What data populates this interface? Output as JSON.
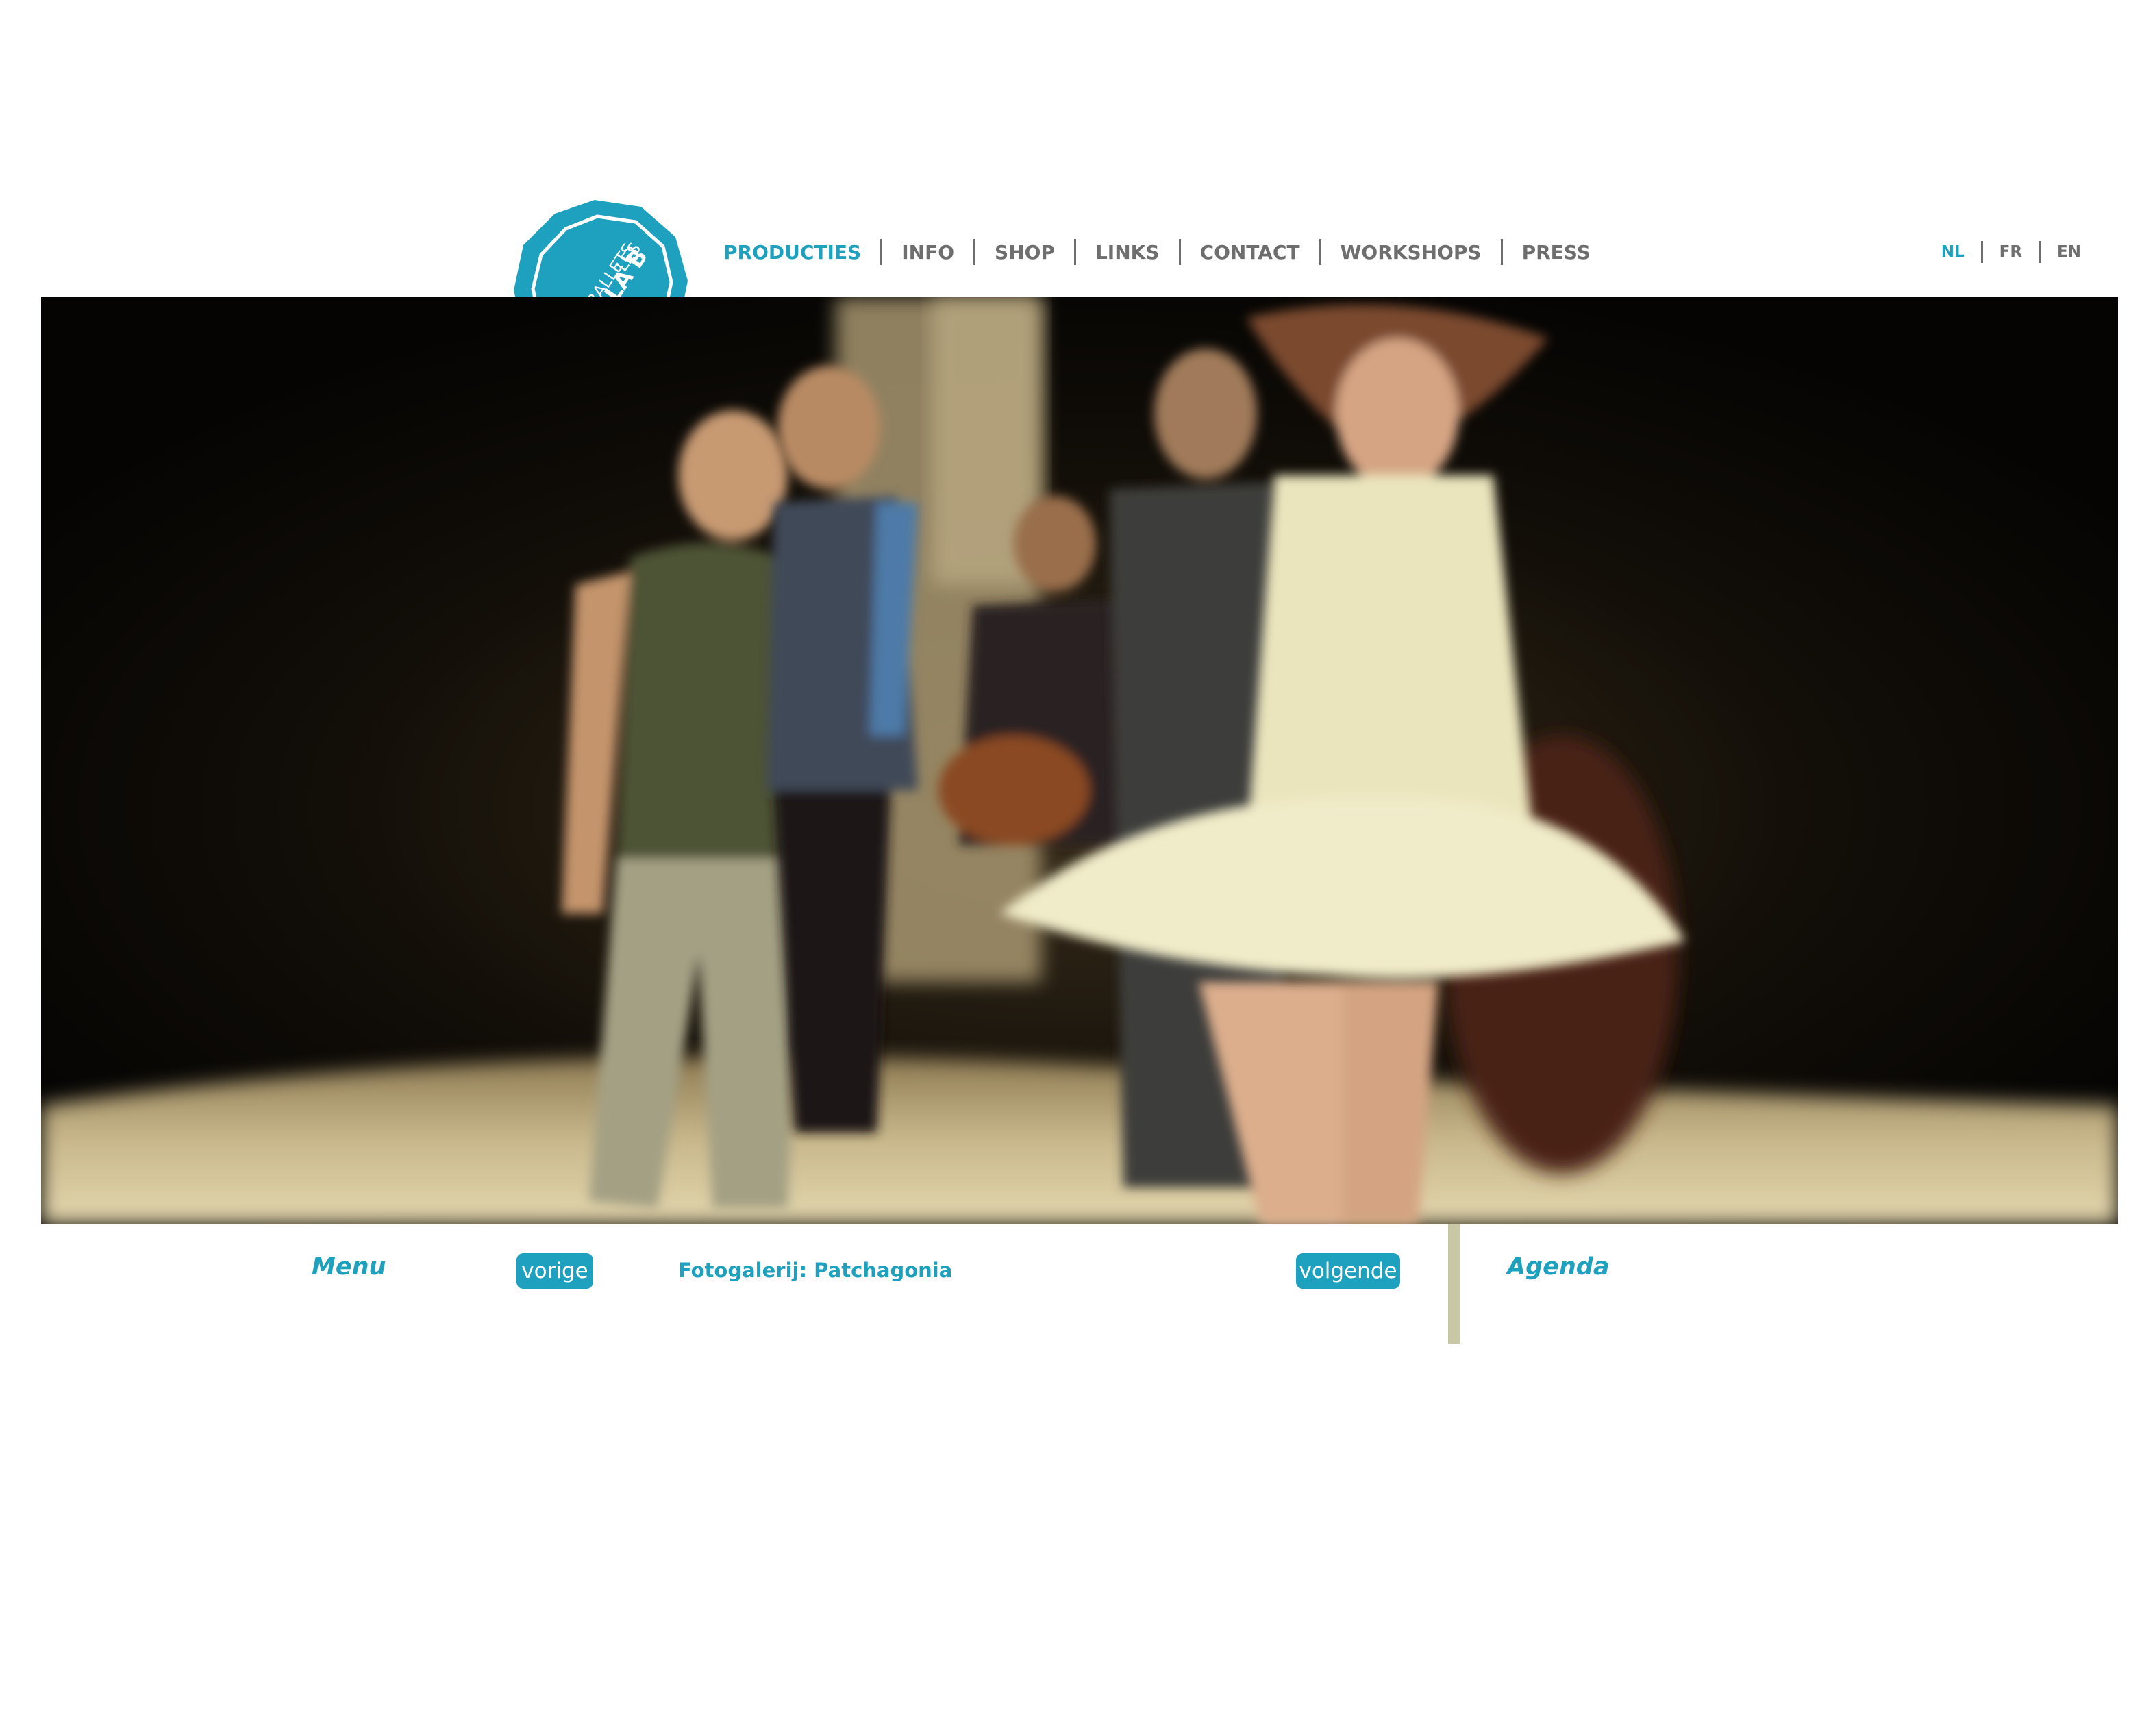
{
  "logo": {
    "line1": "LES",
    "line2": "BALLETS",
    "line3": "C DE LA B",
    "color": "#1ea0bf"
  },
  "main_nav": {
    "items": [
      {
        "label": "PRODUCTIES",
        "active": true
      },
      {
        "label": "INFO",
        "active": false
      },
      {
        "label": "SHOP",
        "active": false
      },
      {
        "label": "LINKS",
        "active": false
      },
      {
        "label": "CONTACT",
        "active": false
      },
      {
        "label": "WORKSHOPS",
        "active": false
      },
      {
        "label": "PRESS",
        "active": false
      }
    ]
  },
  "language_nav": {
    "items": [
      {
        "label": "NL",
        "active": true
      },
      {
        "label": "FR",
        "active": false
      },
      {
        "label": "EN",
        "active": false
      }
    ]
  },
  "gallery": {
    "menu_label": "Menu",
    "prev_label": "vorige",
    "title": "Fotogalerij: Patchagonia",
    "next_label": "volgende",
    "agenda_label": "Agenda"
  },
  "colors": {
    "accent": "#1ea0bf",
    "nav_text": "#6e6e6e",
    "divider": "#c8c8a6",
    "background": "#ffffff"
  }
}
